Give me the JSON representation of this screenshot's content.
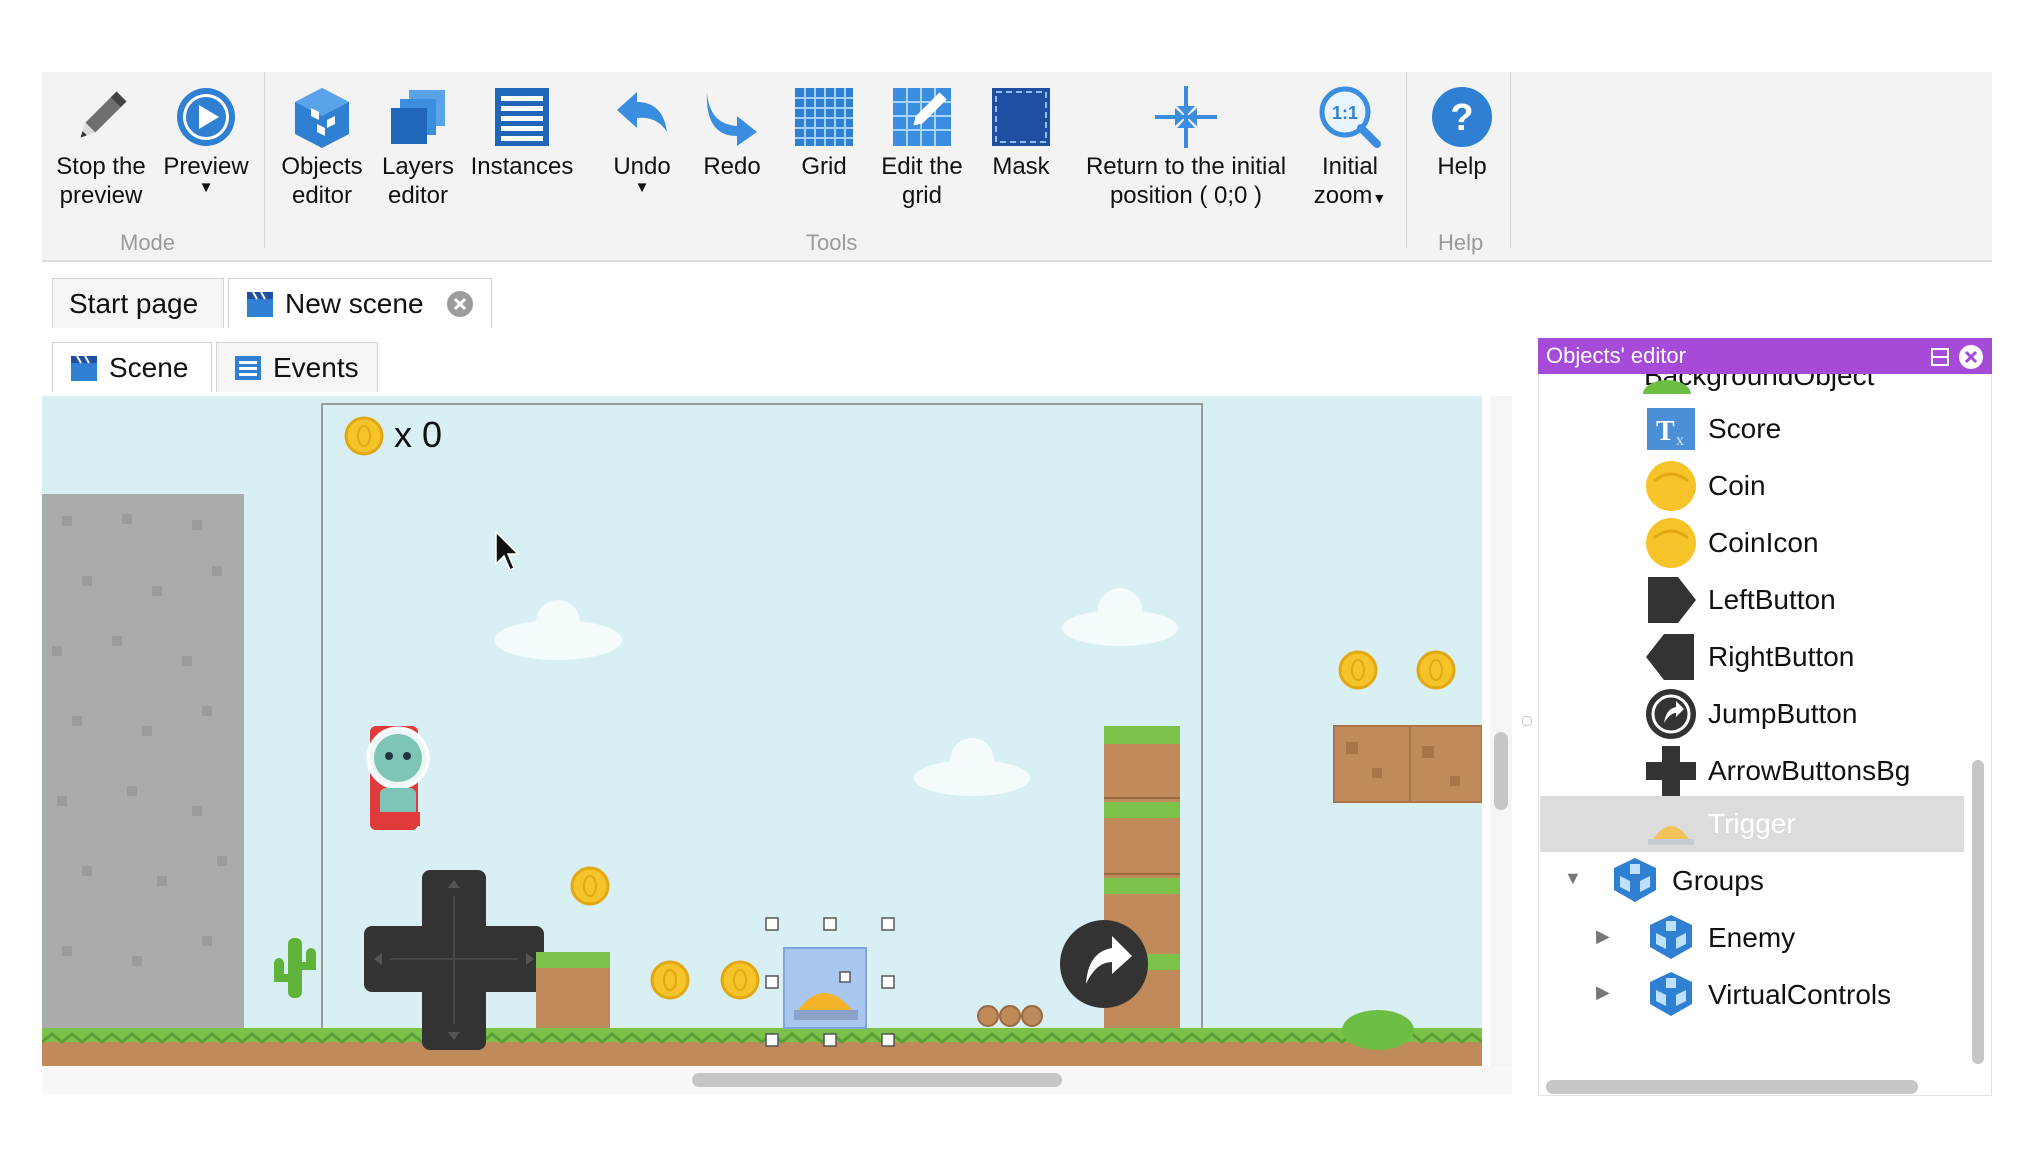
{
  "toolbar": {
    "mode_group": "Mode",
    "tools_group": "Tools",
    "help_group": "Help",
    "buttons": [
      {
        "label": "Stop the\npreview",
        "icon": "pencil-icon"
      },
      {
        "label": "Preview",
        "icon": "play-icon"
      },
      {
        "label": "Objects\neditor",
        "icon": "objects-editor-icon"
      },
      {
        "label": "Layers\neditor",
        "icon": "layers-icon"
      },
      {
        "label": "Instances",
        "icon": "instances-list-icon"
      },
      {
        "label": "Undo",
        "icon": "undo-icon"
      },
      {
        "label": "Redo",
        "icon": "redo-icon"
      },
      {
        "label": "Grid",
        "icon": "grid-icon"
      },
      {
        "label": "Edit the\ngrid",
        "icon": "edit-grid-icon"
      },
      {
        "label": "Mask",
        "icon": "mask-icon"
      },
      {
        "label": "Return to the initial\nposition ( 0;0 )",
        "icon": "crosshair-icon"
      },
      {
        "label": "Initial\nzoom",
        "icon": "zoom-icon"
      },
      {
        "label": "Help",
        "icon": "help-icon"
      }
    ]
  },
  "tabs": {
    "start_page": "Start page",
    "new_scene": "New scene",
    "scene": "Scene",
    "events": "Events"
  },
  "scene": {
    "coin_counter": "x 0"
  },
  "objects_panel": {
    "title": "Objects' editor",
    "partial_item": "BackgroundObject",
    "items": [
      "Score",
      "Coin",
      "CoinIcon",
      "LeftButton",
      "RightButton",
      "JumpButton",
      "ArrowButtonsBg",
      "Trigger"
    ],
    "selected": "Trigger",
    "groups_label": "Groups",
    "groups": [
      "Enemy",
      "VirtualControls"
    ]
  },
  "colors": {
    "panel_header": "#a64bd8",
    "sky": "#d8eff4",
    "ribbon_blue": "#2f7fd3"
  }
}
